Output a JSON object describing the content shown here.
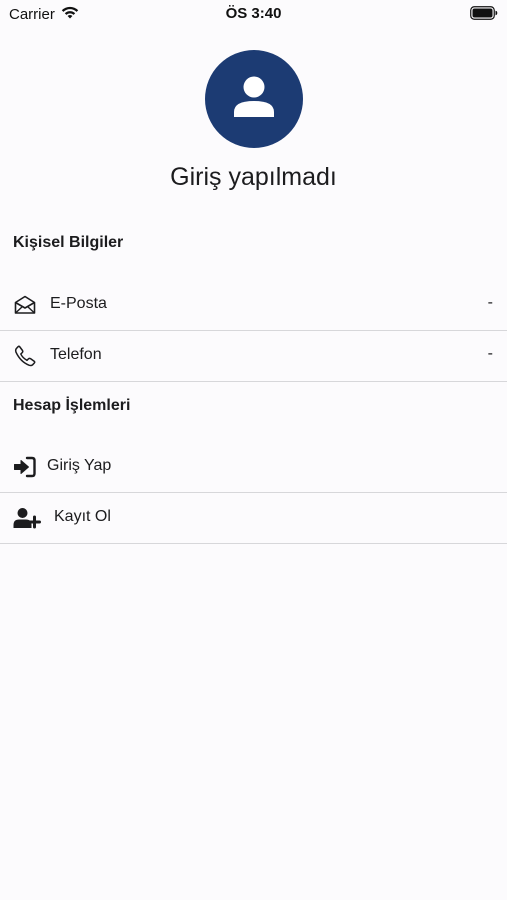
{
  "status_bar": {
    "carrier": "Carrier",
    "time": "ÖS 3:40"
  },
  "profile": {
    "name": "Giriş yapılmadı",
    "avatar_color": "#1c3b73"
  },
  "personal_info": {
    "title": "Kişisel Bilgiler",
    "email": {
      "label": "E-Posta",
      "value": "-"
    },
    "phone": {
      "label": "Telefon",
      "value": "-"
    }
  },
  "account_actions": {
    "title": "Hesap İşlemleri",
    "login": {
      "label": "Giriş Yap"
    },
    "register": {
      "label": "Kayıt Ol"
    }
  }
}
